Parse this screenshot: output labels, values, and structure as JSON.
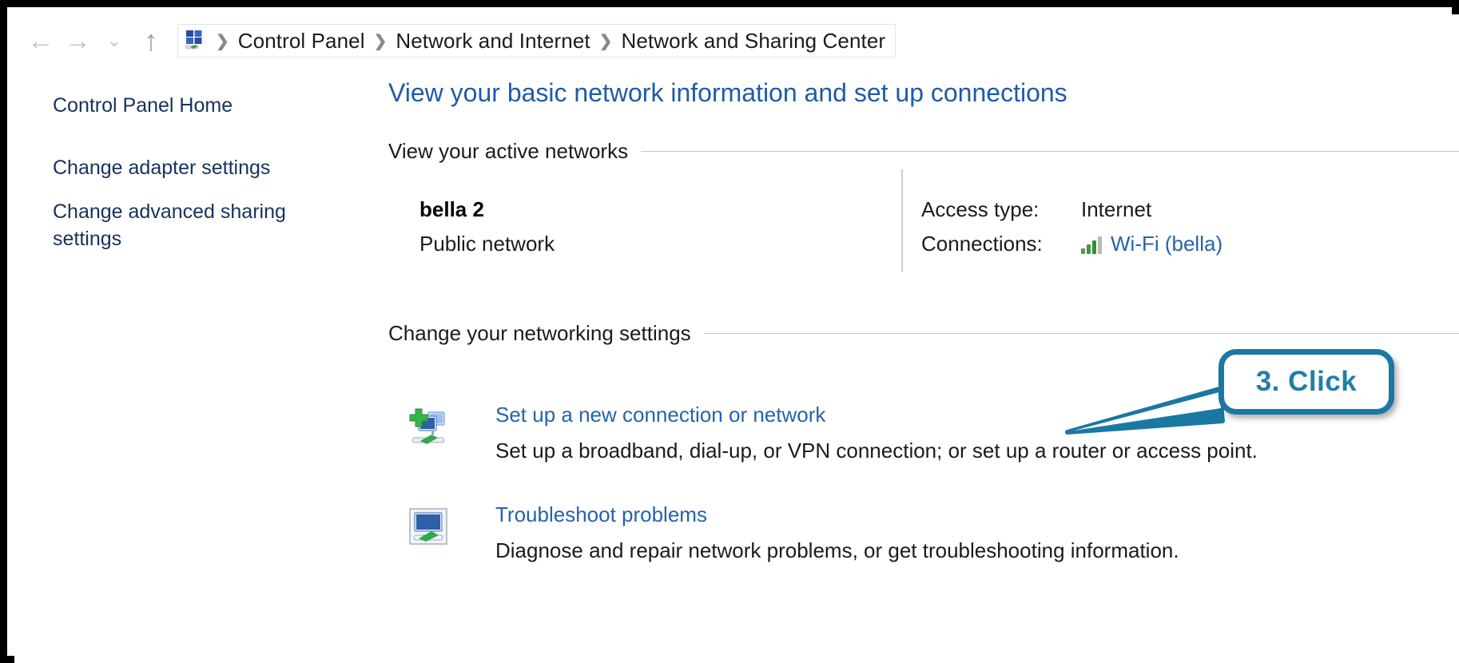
{
  "window": {
    "chrome_border_color": "#000000",
    "background": "#ffffff"
  },
  "addressbar": {
    "nav": [
      {
        "name": "back",
        "glyph": "←",
        "enabled": false
      },
      {
        "name": "forward",
        "glyph": "→",
        "enabled": false
      },
      {
        "name": "recent-locations",
        "glyph": "⌄",
        "enabled": true
      },
      {
        "name": "up",
        "glyph": "↑",
        "enabled": true
      }
    ],
    "icon": "control-panel-icon",
    "separator": "❯",
    "breadcrumbs": [
      "Control Panel",
      "Network and Internet",
      "Network and Sharing Center"
    ]
  },
  "sidebar": {
    "items": [
      {
        "label": "Control Panel Home"
      },
      {
        "label": "Change adapter settings"
      },
      {
        "label": "Change advanced sharing settings"
      }
    ]
  },
  "main": {
    "title": "View your basic network information and set up connections",
    "title_color": "#1f5ba8",
    "sections": [
      {
        "heading": "View your active networks"
      },
      {
        "heading": "Change your networking settings"
      }
    ],
    "active_network": {
      "name": "bella  2",
      "type": "Public network",
      "details": [
        {
          "label": "Access type:",
          "value": "Internet",
          "is_link": false
        },
        {
          "label": "Connections:",
          "value": "Wi-Fi (bella)",
          "is_link": true,
          "icon": "wifi-signal-icon"
        }
      ]
    },
    "tasks": [
      {
        "icon": "new-connection-icon",
        "link": "Set up a new connection or network",
        "description": "Set up a broadband, dial-up, or VPN connection; or set up a router or access point."
      },
      {
        "icon": "troubleshoot-icon",
        "link": "Troubleshoot problems",
        "description": "Diagnose and repair network problems, or get troubleshooting information."
      }
    ],
    "link_color": "#2563ac"
  },
  "callout": {
    "text": "3. Click",
    "border_color": "#1a78a2",
    "text_color": "#1f7fa8",
    "points_to": "Set up a new connection or network"
  }
}
